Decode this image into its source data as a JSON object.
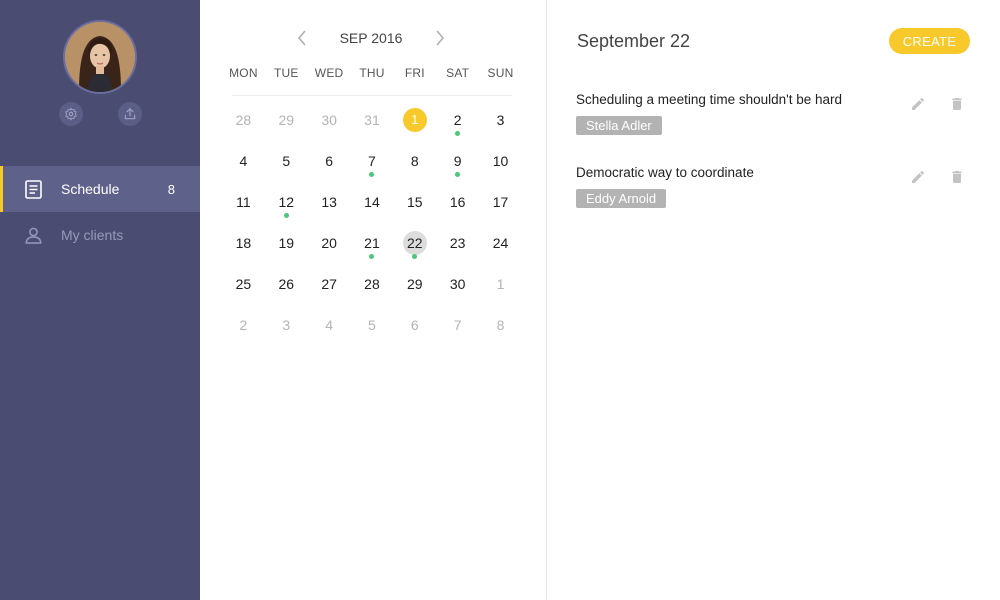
{
  "sidebar": {
    "icons": {
      "settings": "gear-icon",
      "upload": "upload-icon"
    },
    "nav": [
      {
        "label": "Schedule",
        "count": "8",
        "icon": "document-icon",
        "active": true
      },
      {
        "label": "My clients",
        "count": "",
        "icon": "user-icon",
        "active": false
      }
    ]
  },
  "calendar": {
    "month_label": "SEP 2016",
    "weekdays": [
      "MON",
      "TUE",
      "WED",
      "THU",
      "FRI",
      "SAT",
      "SUN"
    ],
    "weeks": [
      [
        {
          "d": "28",
          "m": true
        },
        {
          "d": "29",
          "m": true
        },
        {
          "d": "30",
          "m": true
        },
        {
          "d": "31",
          "m": true
        },
        {
          "d": "1",
          "today": true
        },
        {
          "d": "2",
          "dot": true
        },
        {
          "d": "3"
        }
      ],
      [
        {
          "d": "4"
        },
        {
          "d": "5"
        },
        {
          "d": "6"
        },
        {
          "d": "7",
          "dot": true
        },
        {
          "d": "8"
        },
        {
          "d": "9",
          "dot": true
        },
        {
          "d": "10"
        }
      ],
      [
        {
          "d": "11"
        },
        {
          "d": "12",
          "dot": true
        },
        {
          "d": "13"
        },
        {
          "d": "14"
        },
        {
          "d": "15"
        },
        {
          "d": "16"
        },
        {
          "d": "17"
        }
      ],
      [
        {
          "d": "18"
        },
        {
          "d": "19"
        },
        {
          "d": "20"
        },
        {
          "d": "21",
          "dot": true
        },
        {
          "d": "22",
          "selected": true,
          "dot": true
        },
        {
          "d": "23"
        },
        {
          "d": "24"
        }
      ],
      [
        {
          "d": "25"
        },
        {
          "d": "26"
        },
        {
          "d": "27"
        },
        {
          "d": "28"
        },
        {
          "d": "29"
        },
        {
          "d": "30"
        },
        {
          "d": "1",
          "m": true
        }
      ],
      [
        {
          "d": "2",
          "m": true
        },
        {
          "d": "3",
          "m": true
        },
        {
          "d": "4",
          "m": true
        },
        {
          "d": "5",
          "m": true
        },
        {
          "d": "6",
          "m": true
        },
        {
          "d": "7",
          "m": true
        },
        {
          "d": "8",
          "m": true
        }
      ]
    ],
    "colors": {
      "accent": "#f7c92a",
      "event_dot": "#4cc77a",
      "selected": "#dcdcdc"
    }
  },
  "detail": {
    "title": "September 22",
    "create_label": "CREATE",
    "events": [
      {
        "title": "Scheduling a meeting time shouldn't be hard",
        "person": "Stella Adler"
      },
      {
        "title": "Democratic way to coordinate",
        "person": "Eddy Arnold"
      }
    ]
  },
  "colors": {
    "sidebar_bg": "#4a4c72",
    "sidebar_active": "#5e6189",
    "accent": "#f7c92a",
    "tag_bg": "#b3b3b3"
  }
}
